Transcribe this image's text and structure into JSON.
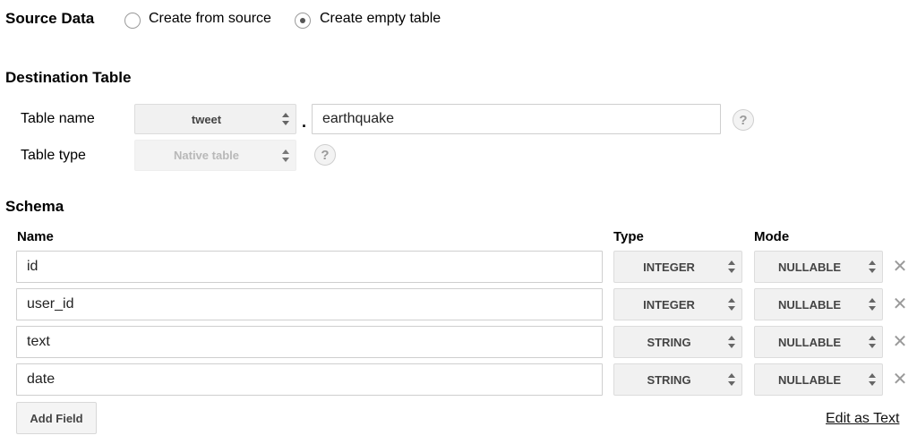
{
  "source_data": {
    "heading": "Source Data",
    "options": [
      {
        "label": "Create from source",
        "checked": false
      },
      {
        "label": "Create empty table",
        "checked": true
      }
    ]
  },
  "destination": {
    "heading": "Destination Table",
    "table_name_label": "Table name",
    "dataset_value": "tweet",
    "separator": ".",
    "table_name_value": "earthquake",
    "table_type_label": "Table type",
    "table_type_value": "Native table",
    "help_glyph": "?"
  },
  "schema": {
    "heading": "Schema",
    "columns": {
      "name": "Name",
      "type": "Type",
      "mode": "Mode"
    },
    "fields": [
      {
        "name": "id",
        "type": "INTEGER",
        "mode": "NULLABLE"
      },
      {
        "name": "user_id",
        "type": "INTEGER",
        "mode": "NULLABLE"
      },
      {
        "name": "text",
        "type": "STRING",
        "mode": "NULLABLE"
      },
      {
        "name": "date",
        "type": "STRING",
        "mode": "NULLABLE"
      }
    ],
    "remove_glyph": "✕",
    "add_field_label": "Add Field",
    "edit_as_text_label": "Edit as Text"
  },
  "icons": {
    "select_arrows": "updown-arrows-icon",
    "help": "help-icon",
    "remove": "close-icon"
  },
  "colors": {
    "select_bg": "#f1f1f1",
    "border": "#cfcfcf",
    "muted": "#9a9a9a"
  }
}
